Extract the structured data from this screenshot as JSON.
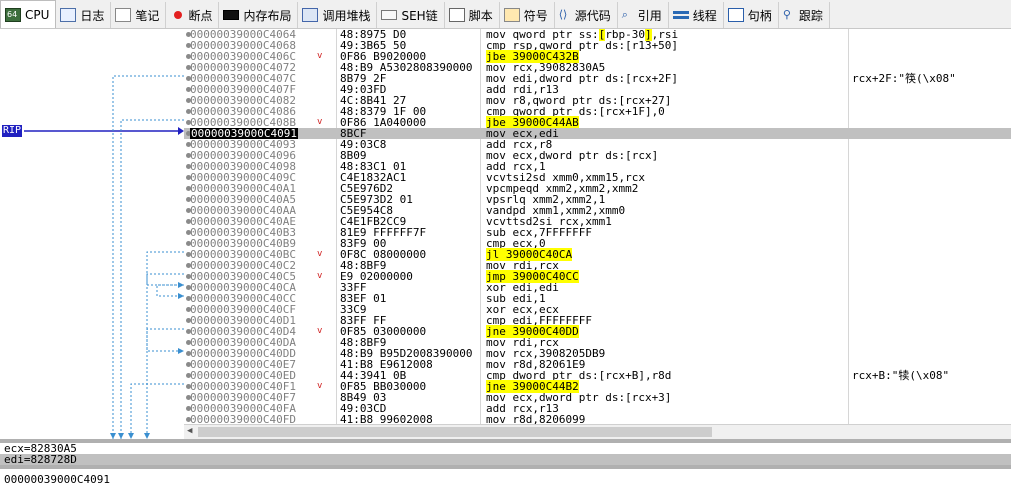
{
  "tabs": [
    {
      "label": "CPU",
      "icon": "cpu-icon",
      "active": true
    },
    {
      "label": "日志",
      "icon": "log-icon"
    },
    {
      "label": "笔记",
      "icon": "notes-icon"
    },
    {
      "label": "断点",
      "icon": "breakpoint-icon"
    },
    {
      "label": "内存布局",
      "icon": "memory-map-icon"
    },
    {
      "label": "调用堆栈",
      "icon": "call-stack-icon"
    },
    {
      "label": "SEH链",
      "icon": "seh-chain-icon"
    },
    {
      "label": "脚本",
      "icon": "script-icon"
    },
    {
      "label": "符号",
      "icon": "symbols-icon"
    },
    {
      "label": "源代码",
      "icon": "source-icon"
    },
    {
      "label": "引用",
      "icon": "references-icon"
    },
    {
      "label": "线程",
      "icon": "threads-icon"
    },
    {
      "label": "句柄",
      "icon": "handles-icon"
    },
    {
      "label": "跟踪",
      "icon": "trace-icon"
    }
  ],
  "rip_label": "RIP",
  "rows": [
    {
      "addr": "00000039000C4064",
      "jmp": "",
      "bytes": "48:8975 D0",
      "asm": [
        [
          "mov qword ptr ss:",
          ""
        ],
        [
          "[",
          "hlbracket"
        ],
        [
          "rbp-30",
          ""
        ],
        [
          "]",
          "hlbracket"
        ],
        [
          ",rsi",
          ""
        ]
      ],
      "cmt": ""
    },
    {
      "addr": "00000039000C4068",
      "jmp": "",
      "bytes": "49:3B65 50",
      "asm": [
        [
          "cmp rsp,qword ptr ds:[r13+50]",
          ""
        ]
      ],
      "cmt": ""
    },
    {
      "addr": "00000039000C406C",
      "jmp": "v",
      "bytes": "0F86 B9020000",
      "asm": [
        [
          "jbe 39000C432B",
          "hl"
        ]
      ],
      "cmt": ""
    },
    {
      "addr": "00000039000C4072",
      "jmp": "",
      "bytes": "48:B9 A5302808390000",
      "asm": [
        [
          "mov rcx,39082830A5",
          ""
        ]
      ],
      "cmt": ""
    },
    {
      "addr": "00000039000C407C",
      "jmp": "",
      "bytes": "8B79 2F",
      "asm": [
        [
          "mov edi,dword ptr ds:[rcx+2F]",
          ""
        ]
      ],
      "cmt": "rcx+2F:\"筷(\\x08\""
    },
    {
      "addr": "00000039000C407F",
      "jmp": "",
      "bytes": "49:03FD",
      "asm": [
        [
          "add rdi,r13",
          ""
        ]
      ],
      "cmt": ""
    },
    {
      "addr": "00000039000C4082",
      "jmp": "",
      "bytes": "4C:8B41 27",
      "asm": [
        [
          "mov r8,qword ptr ds:[rcx+27]",
          ""
        ]
      ],
      "cmt": ""
    },
    {
      "addr": "00000039000C4086",
      "jmp": "",
      "bytes": "48:8379 1F 00",
      "asm": [
        [
          "cmp qword ptr ds:[rcx+1F],0",
          ""
        ]
      ],
      "cmt": ""
    },
    {
      "addr": "00000039000C408B",
      "jmp": "v",
      "bytes": "0F86 1A040000",
      "asm": [
        [
          "jbe 39000C44AB",
          "hl"
        ]
      ],
      "cmt": ""
    },
    {
      "addr": "00000039000C4091",
      "jmp": "",
      "bytes": "8BCF",
      "asm": [
        [
          "mov ecx,edi",
          ""
        ]
      ],
      "cmt": "",
      "sel": true
    },
    {
      "addr": "00000039000C4093",
      "jmp": "",
      "bytes": "49:03C8",
      "asm": [
        [
          "add rcx,r8",
          ""
        ]
      ],
      "cmt": ""
    },
    {
      "addr": "00000039000C4096",
      "jmp": "",
      "bytes": "8B09",
      "asm": [
        [
          "mov ecx,dword ptr ds:[rcx]",
          ""
        ]
      ],
      "cmt": ""
    },
    {
      "addr": "00000039000C4098",
      "jmp": "",
      "bytes": "48:83C1 01",
      "asm": [
        [
          "add rcx,1",
          ""
        ]
      ],
      "cmt": ""
    },
    {
      "addr": "00000039000C409C",
      "jmp": "",
      "bytes": "C4E1832AC1",
      "asm": [
        [
          "vcvtsi2sd xmm0,xmm15,rcx",
          ""
        ]
      ],
      "cmt": ""
    },
    {
      "addr": "00000039000C40A1",
      "jmp": "",
      "bytes": "C5E976D2",
      "asm": [
        [
          "vpcmpeqd xmm2,xmm2,xmm2",
          ""
        ]
      ],
      "cmt": ""
    },
    {
      "addr": "00000039000C40A5",
      "jmp": "",
      "bytes": "C5E973D2 01",
      "asm": [
        [
          "vpsrlq xmm2,xmm2,1",
          ""
        ]
      ],
      "cmt": ""
    },
    {
      "addr": "00000039000C40AA",
      "jmp": "",
      "bytes": "C5E954C8",
      "asm": [
        [
          "vandpd xmm1,xmm2,xmm0",
          ""
        ]
      ],
      "cmt": ""
    },
    {
      "addr": "00000039000C40AE",
      "jmp": "",
      "bytes": "C4E1FB2CC9",
      "asm": [
        [
          "vcvttsd2si rcx,xmm1",
          ""
        ]
      ],
      "cmt": ""
    },
    {
      "addr": "00000039000C40B3",
      "jmp": "",
      "bytes": "81E9 FFFFFF7F",
      "asm": [
        [
          "sub ecx,7FFFFFFF",
          ""
        ]
      ],
      "cmt": ""
    },
    {
      "addr": "00000039000C40B9",
      "jmp": "",
      "bytes": "83F9 00",
      "asm": [
        [
          "cmp ecx,0",
          ""
        ]
      ],
      "cmt": ""
    },
    {
      "addr": "00000039000C40BC",
      "jmp": "v",
      "bytes": "0F8C 08000000",
      "asm": [
        [
          "jl 39000C40CA",
          "hl"
        ]
      ],
      "cmt": ""
    },
    {
      "addr": "00000039000C40C2",
      "jmp": "",
      "bytes": "48:8BF9",
      "asm": [
        [
          "mov rdi,rcx",
          ""
        ]
      ],
      "cmt": ""
    },
    {
      "addr": "00000039000C40C5",
      "jmp": "v",
      "bytes": "E9 02000000",
      "asm": [
        [
          "jmp 39000C40CC",
          "hl"
        ]
      ],
      "cmt": ""
    },
    {
      "addr": "00000039000C40CA",
      "jmp": "",
      "bytes": "33FF",
      "asm": [
        [
          "xor edi,edi",
          ""
        ]
      ],
      "cmt": ""
    },
    {
      "addr": "00000039000C40CC",
      "jmp": "",
      "bytes": "83EF 01",
      "asm": [
        [
          "sub edi,1",
          ""
        ]
      ],
      "cmt": ""
    },
    {
      "addr": "00000039000C40CF",
      "jmp": "",
      "bytes": "33C9",
      "asm": [
        [
          "xor ecx,ecx",
          ""
        ]
      ],
      "cmt": ""
    },
    {
      "addr": "00000039000C40D1",
      "jmp": "",
      "bytes": "83FF FF",
      "asm": [
        [
          "cmp edi,FFFFFFFF",
          ""
        ]
      ],
      "cmt": ""
    },
    {
      "addr": "00000039000C40D4",
      "jmp": "v",
      "bytes": "0F85 03000000",
      "asm": [
        [
          "jne 39000C40DD",
          "hl"
        ]
      ],
      "cmt": ""
    },
    {
      "addr": "00000039000C40DA",
      "jmp": "",
      "bytes": "48:8BF9",
      "asm": [
        [
          "mov rdi,rcx",
          ""
        ]
      ],
      "cmt": ""
    },
    {
      "addr": "00000039000C40DD",
      "jmp": "",
      "bytes": "48:B9 B95D2008390000",
      "asm": [
        [
          "mov rcx,3908205DB9",
          ""
        ]
      ],
      "cmt": ""
    },
    {
      "addr": "00000039000C40E7",
      "jmp": "",
      "bytes": "41:B8 E9612008",
      "asm": [
        [
          "mov r8d,82061E9",
          ""
        ]
      ],
      "cmt": ""
    },
    {
      "addr": "00000039000C40ED",
      "jmp": "",
      "bytes": "44:3941 0B",
      "asm": [
        [
          "cmp dword ptr ds:[rcx+B],r8d",
          ""
        ]
      ],
      "cmt": "rcx+B:\"犊(\\x08\""
    },
    {
      "addr": "00000039000C40F1",
      "jmp": "v",
      "bytes": "0F85 BB030000",
      "asm": [
        [
          "jne 39000C44B2",
          "hl"
        ]
      ],
      "cmt": ""
    },
    {
      "addr": "00000039000C40F7",
      "jmp": "",
      "bytes": "8B49 03",
      "asm": [
        [
          "mov ecx,dword ptr ds:[rcx+3]",
          ""
        ]
      ],
      "cmt": ""
    },
    {
      "addr": "00000039000C40FA",
      "jmp": "",
      "bytes": "49:03CD",
      "asm": [
        [
          "add rcx,r13",
          ""
        ]
      ],
      "cmt": ""
    },
    {
      "addr": "00000039000C40FD",
      "jmp": "",
      "bytes": "41:B8 99602008",
      "asm": [
        [
          "mov r8d,8206099",
          ""
        ]
      ],
      "cmt": ""
    }
  ],
  "info_lines": [
    "ecx=82830A5",
    "edi=828728D"
  ],
  "status_address": "00000039000C4091"
}
